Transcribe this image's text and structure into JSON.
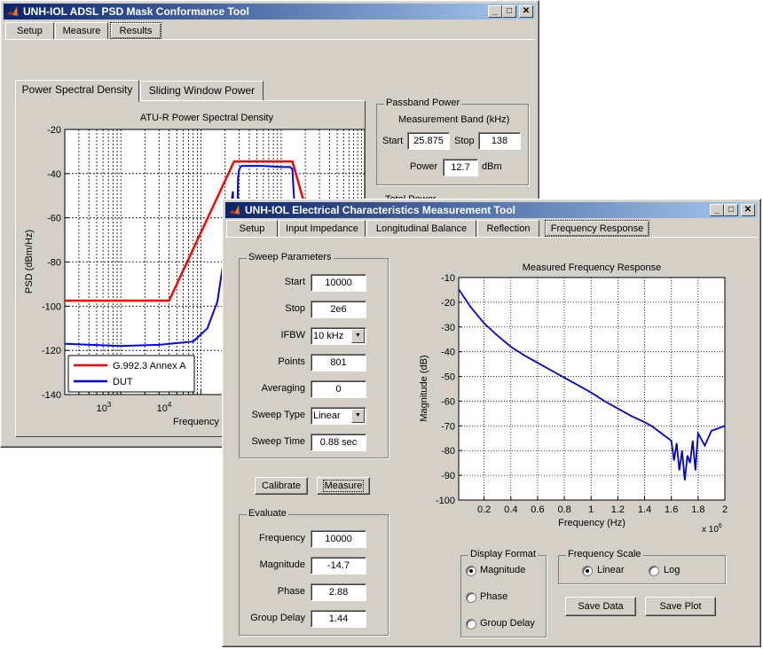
{
  "back_window": {
    "title": "UNH-IOL ADSL PSD Mask Conformance Tool",
    "controls": {
      "minimize": "_",
      "maximize": "□",
      "close": "✕"
    },
    "top_tabs": [
      "Setup",
      "Measure",
      "Results"
    ],
    "selected_top_tab": "Results",
    "sub_tabs": [
      "Power Spectral Density",
      "Sliding Window Power"
    ],
    "passband": {
      "title": "Passband Power",
      "band_label": "Measurement Band (kHz)",
      "start_label": "Start",
      "start_value": "25.875",
      "stop_label": "Stop",
      "stop_value": "138",
      "power_label": "Power",
      "power_value": "12.7",
      "power_unit": "dBm"
    },
    "total_power_partial": "Total Power"
  },
  "front_window": {
    "title": "UNH-IOL Electrical Characteristics Measurement Tool",
    "controls": {
      "minimize": "_",
      "maximize": "□",
      "close": "✕"
    },
    "tabs": [
      "Setup",
      "Input Impedance",
      "Longitudinal Balance",
      "Reflection",
      "Frequency Response"
    ],
    "selected_tab": "Frequency Response",
    "sweep": {
      "title": "Sweep Parameters",
      "start_label": "Start",
      "start_value": "10000",
      "stop_label": "Stop",
      "stop_value": "2e6",
      "ifbw_label": "IFBW",
      "ifbw_value": "10 kHz",
      "points_label": "Points",
      "points_value": "801",
      "averaging_label": "Averaging",
      "averaging_value": "0",
      "sweep_type_label": "Sweep Type",
      "sweep_type_value": "Linear",
      "sweep_time_label": "Sweep Time",
      "sweep_time_value": "0.88 sec"
    },
    "calibrate_label": "Calibrate",
    "measure_label": "Measure",
    "evaluate": {
      "title": "Evaluate",
      "frequency_label": "Frequency",
      "frequency_value": "10000",
      "magnitude_label": "Magnitude",
      "magnitude_value": "-14.7",
      "phase_label": "Phase",
      "phase_value": "2.88",
      "group_delay_label": "Group Delay",
      "group_delay_value": "1.44"
    },
    "display_format": {
      "title": "Display Format",
      "options": [
        "Magnitude",
        "Phase",
        "Group Delay"
      ],
      "selected": "Magnitude"
    },
    "frequency_scale": {
      "title": "Frequency Scale",
      "options": [
        "Linear",
        "Log"
      ],
      "selected": "Linear"
    },
    "save_data_label": "Save Data",
    "save_plot_label": "Save Plot"
  },
  "chart_data": [
    {
      "type": "line",
      "title": "ATU-R Power Spectral Density",
      "xlabel": "Frequency (",
      "ylabel": "PSD (dBm/Hz)",
      "x_scale": "log",
      "xlim": [
        200,
        1100000
      ],
      "ylim": [
        -140,
        -20
      ],
      "yticks": [
        "-20",
        "-40",
        "-60",
        "-80",
        "-100",
        "-120",
        "-140"
      ],
      "xticks": [
        "10^3",
        "10^4"
      ],
      "grid": true,
      "legend_position": "bottom-left",
      "series": [
        {
          "name": "G.992.3 Annex A",
          "color": "#ff0000",
          "x": [
            200,
            4000,
            25875,
            138000,
            200000
          ],
          "y": [
            -97.5,
            -97.5,
            -34.5,
            -34.5,
            -55
          ]
        },
        {
          "name": "DUT",
          "color": "#0000ff",
          "x": [
            200,
            1000,
            3000,
            8000,
            12000,
            16000,
            20000,
            22000,
            25000,
            26000,
            27000,
            29000,
            30000,
            32000,
            40000,
            60000,
            100000,
            130000,
            138000,
            150000,
            170000
          ],
          "y": [
            -117,
            -118,
            -117.5,
            -116,
            -110,
            -98,
            -75,
            -63,
            -48,
            -75,
            -109,
            -42,
            -38,
            -36.5,
            -36.5,
            -36.5,
            -37,
            -37,
            -38,
            -60,
            -75
          ]
        }
      ]
    },
    {
      "type": "line",
      "title": "Measured Frequency Response",
      "xlabel": "Frequency (Hz)",
      "ylabel": "Magnitude (dB)",
      "x_multiplier": "x 10^6",
      "xlim": [
        0.01,
        2.0
      ],
      "ylim": [
        -100,
        -10
      ],
      "xticks": [
        "0.2",
        "0.4",
        "0.6",
        "0.8",
        "1",
        "1.2",
        "1.4",
        "1.6",
        "1.8",
        "2"
      ],
      "yticks": [
        "-10",
        "-20",
        "-30",
        "-40",
        "-50",
        "-60",
        "-70",
        "-80",
        "-90",
        "-100"
      ],
      "grid": true,
      "series": [
        {
          "name": "",
          "color": "#0000cc",
          "x": [
            0.01,
            0.05,
            0.1,
            0.2,
            0.3,
            0.4,
            0.5,
            0.6,
            0.7,
            0.8,
            0.9,
            1.0,
            1.1,
            1.2,
            1.3,
            1.4,
            1.45,
            1.5,
            1.55,
            1.6,
            1.62,
            1.64,
            1.66,
            1.68,
            1.7,
            1.72,
            1.74,
            1.76,
            1.78,
            1.8,
            1.85,
            1.9,
            1.95,
            2.0
          ],
          "y": [
            -14.7,
            -18,
            -22,
            -28.5,
            -33.5,
            -38,
            -41.5,
            -44.5,
            -47.5,
            -50.5,
            -53.5,
            -56.5,
            -60,
            -63,
            -66,
            -68.5,
            -70,
            -72,
            -74,
            -76,
            -84,
            -77,
            -88,
            -80,
            -92,
            -82,
            -85,
            -76,
            -88,
            -73,
            -78,
            -72,
            -71,
            -70
          ]
        }
      ]
    }
  ]
}
